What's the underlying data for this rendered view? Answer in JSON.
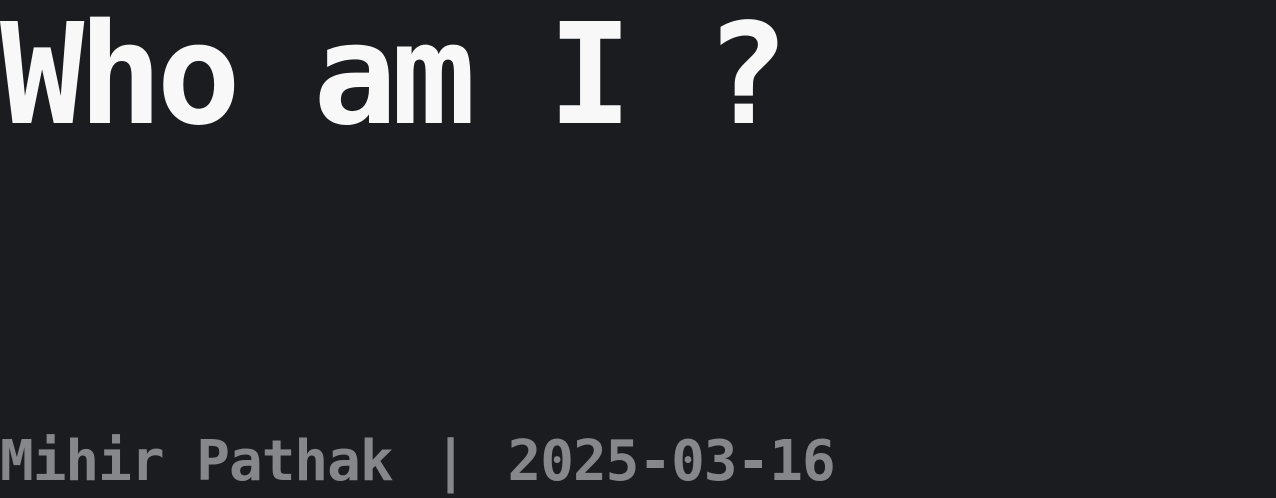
{
  "post": {
    "title": "Who am I ?",
    "author": "Mihir Pathak",
    "separator": "|",
    "date": "2025-03-16"
  },
  "colors": {
    "background": "#1b1c20",
    "title": "#f8f8f8",
    "meta": "#86878b"
  }
}
